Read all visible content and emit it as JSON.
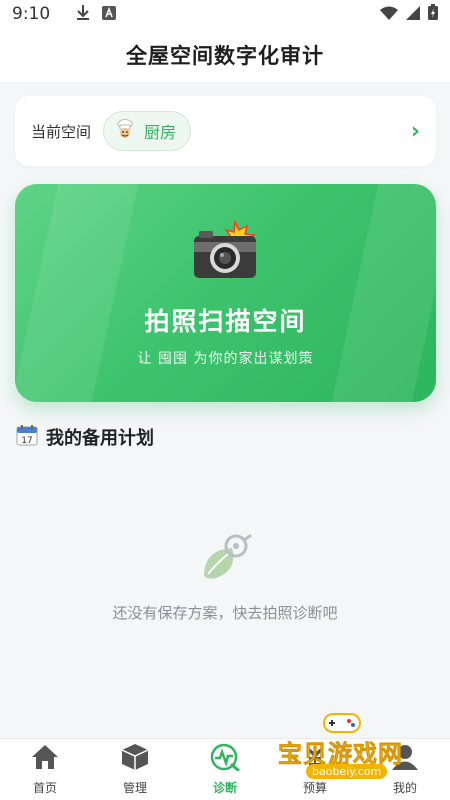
{
  "status_bar": {
    "time": "9:10",
    "icons": [
      "download-icon",
      "a-icon",
      "wifi-icon",
      "signal-icon",
      "battery-icon"
    ]
  },
  "header": {
    "title": "全屋空间数字化审计"
  },
  "current_space": {
    "label": "当前空间",
    "icon": "chef-icon",
    "name": "厨房",
    "chevron": "›"
  },
  "scan_card": {
    "icon": "camera-flash-icon",
    "title": "拍照扫描空间",
    "subtitle": "让 囤囤 为你的家出谋划策"
  },
  "plans": {
    "icon": "calendar-icon",
    "title": "我的备用计划",
    "empty_text": "还没有保存方案，快去拍照诊断吧"
  },
  "tabbar": {
    "items": [
      {
        "label": "首页",
        "icon": "home-icon"
      },
      {
        "label": "管理",
        "icon": "box-icon"
      },
      {
        "label": "诊断",
        "icon": "diagnose-icon",
        "active": true
      },
      {
        "label": "预算",
        "icon": "budget-icon"
      },
      {
        "label": "我的",
        "icon": "profile-icon"
      }
    ]
  },
  "watermark": {
    "text": "宝贝游戏网",
    "url": "baobeiy.com"
  },
  "colors": {
    "accent": "#2fb45e",
    "card_gradient_start": "#5fd486",
    "card_gradient_end": "#2cb55d"
  }
}
